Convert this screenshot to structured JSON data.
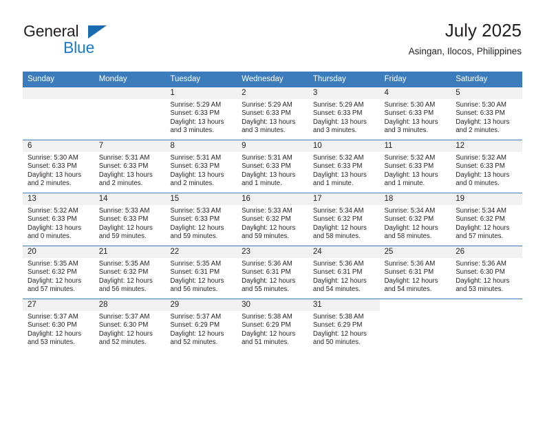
{
  "brand": {
    "name_primary": "General",
    "name_secondary": "Blue",
    "triangle_icon": "triangle-icon",
    "primary_color": "#231f20",
    "secondary_color": "#1a7bc4",
    "triangle_color": "#1a6cb0"
  },
  "header": {
    "title": "July 2025",
    "subtitle": "Asingan, Ilocos, Philippines"
  },
  "theme": {
    "header_row_bg": "#3d7cbc",
    "header_row_text": "#ffffff",
    "daynum_band_bg": "#f1f1f1",
    "grid_line": "#3d7cbc",
    "body_text": "#231f20"
  },
  "weekdays": [
    "Sunday",
    "Monday",
    "Tuesday",
    "Wednesday",
    "Thursday",
    "Friday",
    "Saturday"
  ],
  "weeks": [
    [
      {
        "blank": true,
        "leading": true
      },
      {
        "blank": true,
        "leading": true
      },
      {
        "day": "1",
        "sunrise": "Sunrise: 5:29 AM",
        "sunset": "Sunset: 6:33 PM",
        "daylight1": "Daylight: 13 hours",
        "daylight2": "and 3 minutes."
      },
      {
        "day": "2",
        "sunrise": "Sunrise: 5:29 AM",
        "sunset": "Sunset: 6:33 PM",
        "daylight1": "Daylight: 13 hours",
        "daylight2": "and 3 minutes."
      },
      {
        "day": "3",
        "sunrise": "Sunrise: 5:29 AM",
        "sunset": "Sunset: 6:33 PM",
        "daylight1": "Daylight: 13 hours",
        "daylight2": "and 3 minutes."
      },
      {
        "day": "4",
        "sunrise": "Sunrise: 5:30 AM",
        "sunset": "Sunset: 6:33 PM",
        "daylight1": "Daylight: 13 hours",
        "daylight2": "and 3 minutes."
      },
      {
        "day": "5",
        "sunrise": "Sunrise: 5:30 AM",
        "sunset": "Sunset: 6:33 PM",
        "daylight1": "Daylight: 13 hours",
        "daylight2": "and 2 minutes."
      }
    ],
    [
      {
        "day": "6",
        "sunrise": "Sunrise: 5:30 AM",
        "sunset": "Sunset: 6:33 PM",
        "daylight1": "Daylight: 13 hours",
        "daylight2": "and 2 minutes."
      },
      {
        "day": "7",
        "sunrise": "Sunrise: 5:31 AM",
        "sunset": "Sunset: 6:33 PM",
        "daylight1": "Daylight: 13 hours",
        "daylight2": "and 2 minutes."
      },
      {
        "day": "8",
        "sunrise": "Sunrise: 5:31 AM",
        "sunset": "Sunset: 6:33 PM",
        "daylight1": "Daylight: 13 hours",
        "daylight2": "and 2 minutes."
      },
      {
        "day": "9",
        "sunrise": "Sunrise: 5:31 AM",
        "sunset": "Sunset: 6:33 PM",
        "daylight1": "Daylight: 13 hours",
        "daylight2": "and 1 minute."
      },
      {
        "day": "10",
        "sunrise": "Sunrise: 5:32 AM",
        "sunset": "Sunset: 6:33 PM",
        "daylight1": "Daylight: 13 hours",
        "daylight2": "and 1 minute."
      },
      {
        "day": "11",
        "sunrise": "Sunrise: 5:32 AM",
        "sunset": "Sunset: 6:33 PM",
        "daylight1": "Daylight: 13 hours",
        "daylight2": "and 1 minute."
      },
      {
        "day": "12",
        "sunrise": "Sunrise: 5:32 AM",
        "sunset": "Sunset: 6:33 PM",
        "daylight1": "Daylight: 13 hours",
        "daylight2": "and 0 minutes."
      }
    ],
    [
      {
        "day": "13",
        "sunrise": "Sunrise: 5:32 AM",
        "sunset": "Sunset: 6:33 PM",
        "daylight1": "Daylight: 13 hours",
        "daylight2": "and 0 minutes."
      },
      {
        "day": "14",
        "sunrise": "Sunrise: 5:33 AM",
        "sunset": "Sunset: 6:33 PM",
        "daylight1": "Daylight: 12 hours",
        "daylight2": "and 59 minutes."
      },
      {
        "day": "15",
        "sunrise": "Sunrise: 5:33 AM",
        "sunset": "Sunset: 6:33 PM",
        "daylight1": "Daylight: 12 hours",
        "daylight2": "and 59 minutes."
      },
      {
        "day": "16",
        "sunrise": "Sunrise: 5:33 AM",
        "sunset": "Sunset: 6:32 PM",
        "daylight1": "Daylight: 12 hours",
        "daylight2": "and 59 minutes."
      },
      {
        "day": "17",
        "sunrise": "Sunrise: 5:34 AM",
        "sunset": "Sunset: 6:32 PM",
        "daylight1": "Daylight: 12 hours",
        "daylight2": "and 58 minutes."
      },
      {
        "day": "18",
        "sunrise": "Sunrise: 5:34 AM",
        "sunset": "Sunset: 6:32 PM",
        "daylight1": "Daylight: 12 hours",
        "daylight2": "and 58 minutes."
      },
      {
        "day": "19",
        "sunrise": "Sunrise: 5:34 AM",
        "sunset": "Sunset: 6:32 PM",
        "daylight1": "Daylight: 12 hours",
        "daylight2": "and 57 minutes."
      }
    ],
    [
      {
        "day": "20",
        "sunrise": "Sunrise: 5:35 AM",
        "sunset": "Sunset: 6:32 PM",
        "daylight1": "Daylight: 12 hours",
        "daylight2": "and 57 minutes."
      },
      {
        "day": "21",
        "sunrise": "Sunrise: 5:35 AM",
        "sunset": "Sunset: 6:32 PM",
        "daylight1": "Daylight: 12 hours",
        "daylight2": "and 56 minutes."
      },
      {
        "day": "22",
        "sunrise": "Sunrise: 5:35 AM",
        "sunset": "Sunset: 6:31 PM",
        "daylight1": "Daylight: 12 hours",
        "daylight2": "and 56 minutes."
      },
      {
        "day": "23",
        "sunrise": "Sunrise: 5:36 AM",
        "sunset": "Sunset: 6:31 PM",
        "daylight1": "Daylight: 12 hours",
        "daylight2": "and 55 minutes."
      },
      {
        "day": "24",
        "sunrise": "Sunrise: 5:36 AM",
        "sunset": "Sunset: 6:31 PM",
        "daylight1": "Daylight: 12 hours",
        "daylight2": "and 54 minutes."
      },
      {
        "day": "25",
        "sunrise": "Sunrise: 5:36 AM",
        "sunset": "Sunset: 6:31 PM",
        "daylight1": "Daylight: 12 hours",
        "daylight2": "and 54 minutes."
      },
      {
        "day": "26",
        "sunrise": "Sunrise: 5:36 AM",
        "sunset": "Sunset: 6:30 PM",
        "daylight1": "Daylight: 12 hours",
        "daylight2": "and 53 minutes."
      }
    ],
    [
      {
        "day": "27",
        "sunrise": "Sunrise: 5:37 AM",
        "sunset": "Sunset: 6:30 PM",
        "daylight1": "Daylight: 12 hours",
        "daylight2": "and 53 minutes."
      },
      {
        "day": "28",
        "sunrise": "Sunrise: 5:37 AM",
        "sunset": "Sunset: 6:30 PM",
        "daylight1": "Daylight: 12 hours",
        "daylight2": "and 52 minutes."
      },
      {
        "day": "29",
        "sunrise": "Sunrise: 5:37 AM",
        "sunset": "Sunset: 6:29 PM",
        "daylight1": "Daylight: 12 hours",
        "daylight2": "and 52 minutes."
      },
      {
        "day": "30",
        "sunrise": "Sunrise: 5:38 AM",
        "sunset": "Sunset: 6:29 PM",
        "daylight1": "Daylight: 12 hours",
        "daylight2": "and 51 minutes."
      },
      {
        "day": "31",
        "sunrise": "Sunrise: 5:38 AM",
        "sunset": "Sunset: 6:29 PM",
        "daylight1": "Daylight: 12 hours",
        "daylight2": "and 50 minutes."
      },
      {
        "blank": true,
        "trailing": true
      },
      {
        "blank": true,
        "trailing": true
      }
    ]
  ]
}
